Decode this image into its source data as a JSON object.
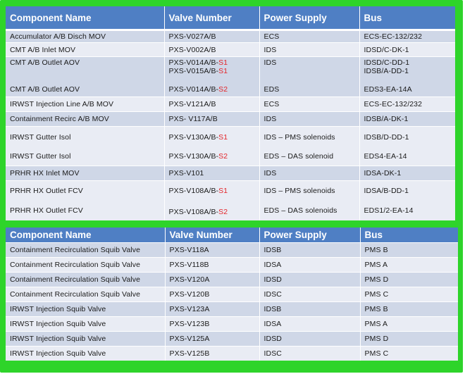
{
  "colors": {
    "header_bg": "#4f7fc4",
    "frame_green": "#2ed42a",
    "row_shade": "#cfd7e7",
    "row_light": "#e9ecf4",
    "suffix_red": "#e3262a"
  },
  "table1": {
    "headers": [
      "Component Name",
      "Valve Number",
      "Power Supply",
      "Bus"
    ],
    "rows": [
      {
        "component": "Accumulator A/B Disch MOV",
        "valve": "PXS-V027A/B",
        "power": "ECS",
        "bus": "ECS-EC-132/232"
      },
      {
        "component": "CMT A/B Inlet MOV",
        "valve": "PXS-V002A/B",
        "power": "IDS",
        "bus": "IDSD/C-DK-1"
      },
      {
        "component": "CMT A/B Outlet AOV",
        "valve_line1_base": "PXS-V014A/B-",
        "valve_line1_suffix": "S1",
        "valve_line2_base": "PXS-V015A/B-",
        "valve_line2_suffix": "S1",
        "power": "IDS",
        "bus_line1": "IDSD/C-DD-1",
        "bus_line2": "IDSB/A-DD-1"
      },
      {
        "component": "CMT A/B Outlet AOV",
        "valve_base": "PXS-V014A/B-",
        "valve_suffix": "S2",
        "power": "EDS",
        "bus": "EDS3-EA-14A"
      },
      {
        "component": "IRWST Injection Line A/B MOV",
        "valve": "PXS-V121A/B",
        "power": "ECS",
        "bus": "ECS-EC-132/232"
      },
      {
        "component": "Containment Recirc A/B MOV",
        "valve": "PXS- V117A/B",
        "power": "IDS",
        "bus": "IDSB/A-DK-1"
      },
      {
        "component": "IRWST Gutter Isol",
        "valve_base": "PXS-V130A/B-",
        "valve_suffix": "S1",
        "power": "IDS – PMS solenoids",
        "bus": "IDSB/D-DD-1"
      },
      {
        "component": "IRWST Gutter Isol",
        "valve_base": "PXS-V130A/B-",
        "valve_suffix": "S2",
        "power": "EDS – DAS solenoid",
        "bus": "EDS4-EA-14"
      },
      {
        "component": "PRHR HX Inlet MOV",
        "valve": "PXS-V101",
        "power": "IDS",
        "bus": "IDSA-DK-1"
      },
      {
        "component": "PRHR HX Outlet FCV",
        "valve_base": "PXS-V108A/B-",
        "valve_suffix": "S1",
        "power": "IDS – PMS solenoids",
        "bus": "IDSA/B-DD-1"
      },
      {
        "component": "PRHR HX Outlet FCV",
        "valve_base": "PXS-V108A/B-",
        "valve_suffix": "S2",
        "power": "EDS – DAS solenoids",
        "bus": "EDS1/2-EA-14"
      }
    ]
  },
  "table2": {
    "headers": [
      "Component Name",
      "Valve Number",
      "Power Supply",
      "Bus"
    ],
    "rows": [
      {
        "component": "Containment Recirculation Squib Valve",
        "valve": "PXS-V118A",
        "power": "IDSB",
        "bus": "PMS B"
      },
      {
        "component": "Containment Recirculation Squib Valve",
        "valve": "PXS-V118B",
        "power": "IDSA",
        "bus": "PMS A"
      },
      {
        "component": "Containment Recirculation Squib Valve",
        "valve": "PXS-V120A",
        "power": "IDSD",
        "bus": "PMS D"
      },
      {
        "component": "Containment Recirculation Squib Valve",
        "valve": "PXS-V120B",
        "power": "IDSC",
        "bus": "PMS C"
      },
      {
        "component": "IRWST Injection Squib Valve",
        "valve": "PXS-V123A",
        "power": "IDSB",
        "bus": "PMS B"
      },
      {
        "component": "IRWST Injection Squib Valve",
        "valve": "PXS-V123B",
        "power": "IDSA",
        "bus": "PMS A"
      },
      {
        "component": "IRWST Injection Squib Valve",
        "valve": "PXS-V125A",
        "power": "IDSD",
        "bus": "PMS D"
      },
      {
        "component": "IRWST Injection Squib Valve",
        "valve": "PXS-V125B",
        "power": "IDSC",
        "bus": "PMS C"
      }
    ]
  }
}
